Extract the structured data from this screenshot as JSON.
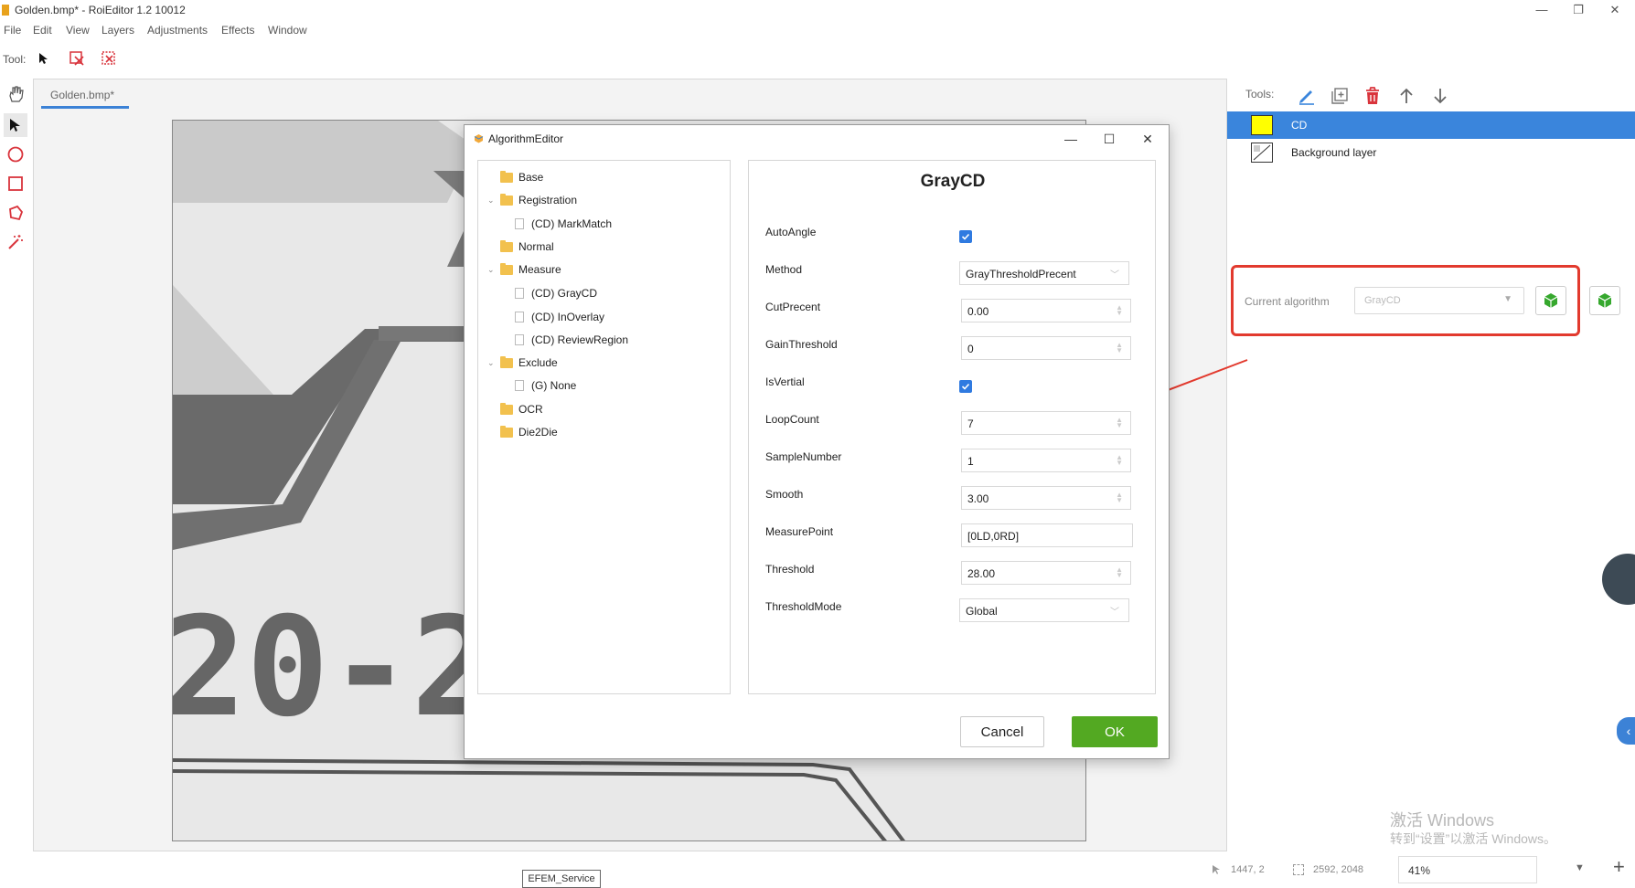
{
  "window": {
    "title": "Golden.bmp* - RoiEditor 1.2 10012",
    "controls": [
      "—",
      "❐",
      "✕"
    ]
  },
  "menu": [
    "File",
    "Edit",
    "View",
    "Layers",
    "Adjustments",
    "Effects",
    "Window"
  ],
  "toolbar": {
    "label": "Tool:"
  },
  "document": {
    "tab_label": "Golden.bmp*",
    "canvas_text": "20-2"
  },
  "dialog": {
    "title": "AlgorithmEditor",
    "tree": [
      {
        "label": "Base",
        "type": "folder",
        "level": 0
      },
      {
        "label": "Registration",
        "type": "folder",
        "level": 0,
        "expanded": true
      },
      {
        "label": "(CD) MarkMatch",
        "type": "item",
        "level": 1
      },
      {
        "label": "Normal",
        "type": "folder",
        "level": 0
      },
      {
        "label": "Measure",
        "type": "folder",
        "level": 0,
        "expanded": true
      },
      {
        "label": "(CD) GrayCD",
        "type": "item",
        "level": 1
      },
      {
        "label": "(CD) InOverlay",
        "type": "item",
        "level": 1
      },
      {
        "label": "(CD) ReviewRegion",
        "type": "item",
        "level": 1
      },
      {
        "label": "Exclude",
        "type": "folder",
        "level": 0,
        "expanded": true
      },
      {
        "label": "(G) None",
        "type": "item",
        "level": 1
      },
      {
        "label": "OCR",
        "type": "folder",
        "level": 0
      },
      {
        "label": "Die2Die",
        "type": "folder",
        "level": 0
      }
    ],
    "prop_title": "GrayCD",
    "props": [
      {
        "label": "AutoAngle",
        "kind": "checkbox",
        "checked": true
      },
      {
        "label": "Method",
        "kind": "select",
        "value": "GrayThresholdPrecent"
      },
      {
        "label": "CutPrecent",
        "kind": "number",
        "value": "0.00"
      },
      {
        "label": "GainThreshold",
        "kind": "number",
        "value": "0"
      },
      {
        "label": "IsVertial",
        "kind": "checkbox",
        "checked": true
      },
      {
        "label": "LoopCount",
        "kind": "number",
        "value": "7"
      },
      {
        "label": "SampleNumber",
        "kind": "number",
        "value": "1"
      },
      {
        "label": "Smooth",
        "kind": "number",
        "value": "3.00"
      },
      {
        "label": "MeasurePoint",
        "kind": "text",
        "value": "[0LD,0RD]"
      },
      {
        "label": "Threshold",
        "kind": "number",
        "value": "28.00"
      },
      {
        "label": "ThresholdMode",
        "kind": "select",
        "value": "Global"
      }
    ],
    "cancel_label": "Cancel",
    "ok_label": "OK"
  },
  "right_panel": {
    "tools_label": "Tools:",
    "layers": [
      {
        "name": "CD",
        "selected": true,
        "swatch": "#ffff00"
      },
      {
        "name": "Background layer",
        "selected": false
      }
    ],
    "current_algorithm_label": "Current algorithm",
    "current_algorithm_value": "GrayCD"
  },
  "status": {
    "service": "EFEM_Service",
    "cursor": "1447, 2",
    "size": "2592, 2048",
    "zoom": "41%"
  },
  "watermark": {
    "line1": "激活 Windows",
    "line2": "转到“设置”以激活 Windows。"
  },
  "colors": {
    "accent": "#3a85dc",
    "ok_green": "#53a922",
    "highlight_red": "#e23a2e",
    "delete_red": "#d9343c"
  }
}
